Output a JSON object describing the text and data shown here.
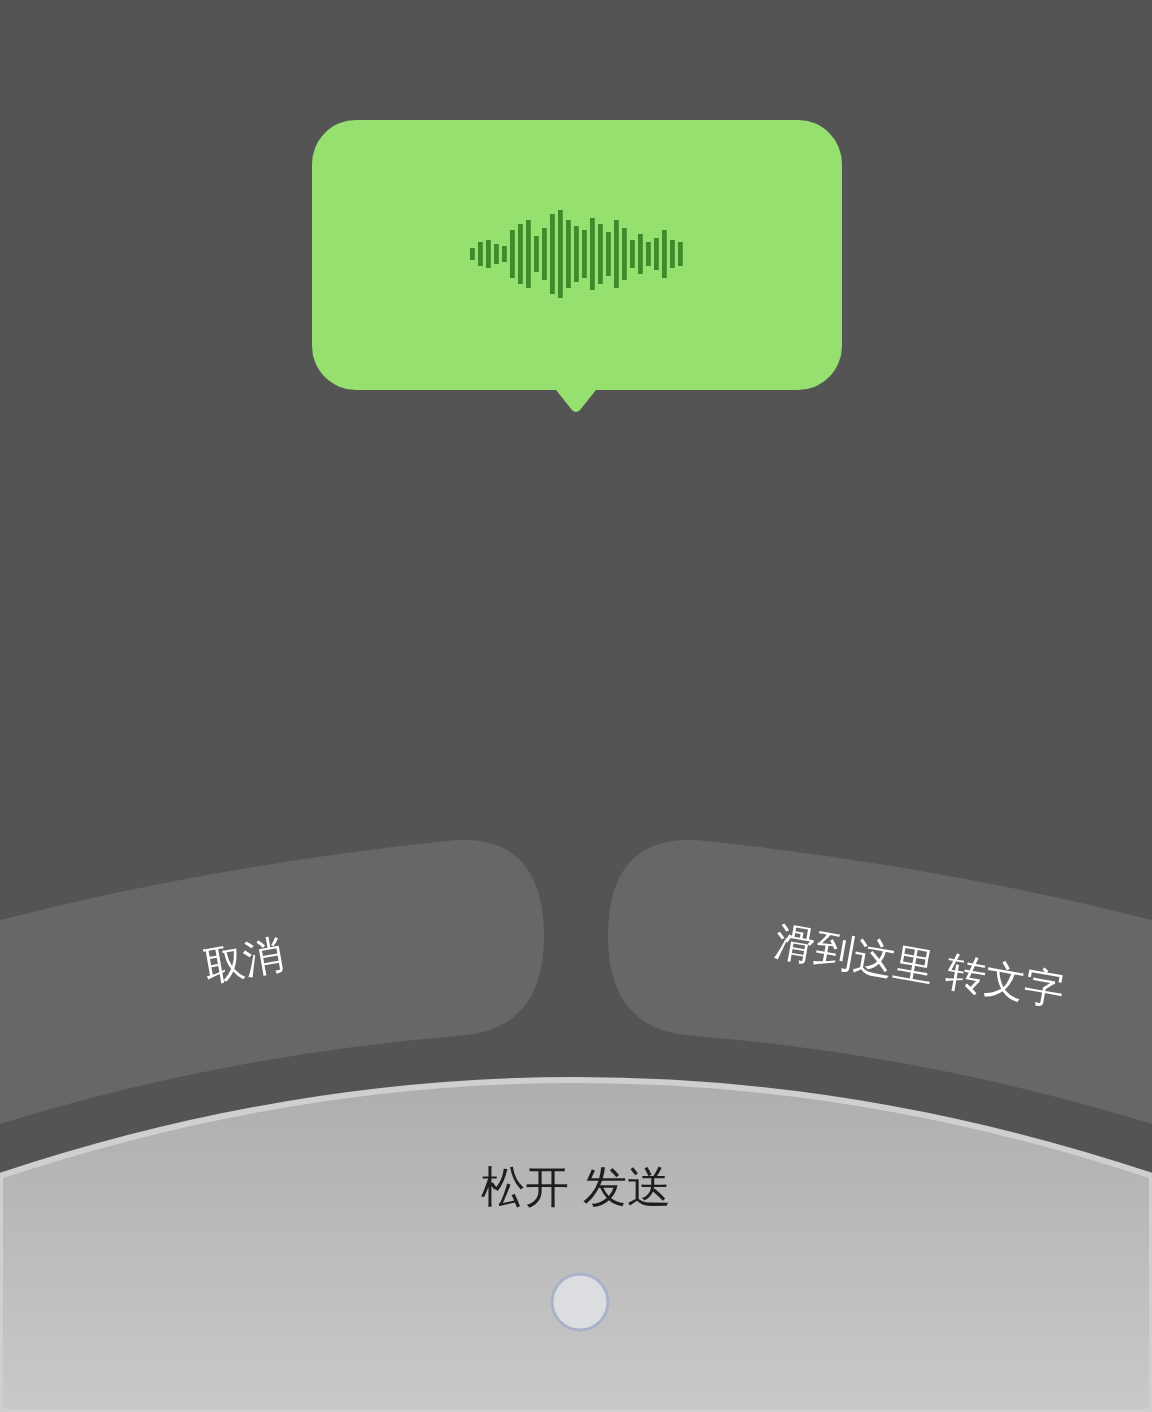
{
  "cancel_button": {
    "label": "取消"
  },
  "transcribe_button": {
    "label": "滑到这里 转文字"
  },
  "send_area": {
    "label": "松开 发送"
  }
}
